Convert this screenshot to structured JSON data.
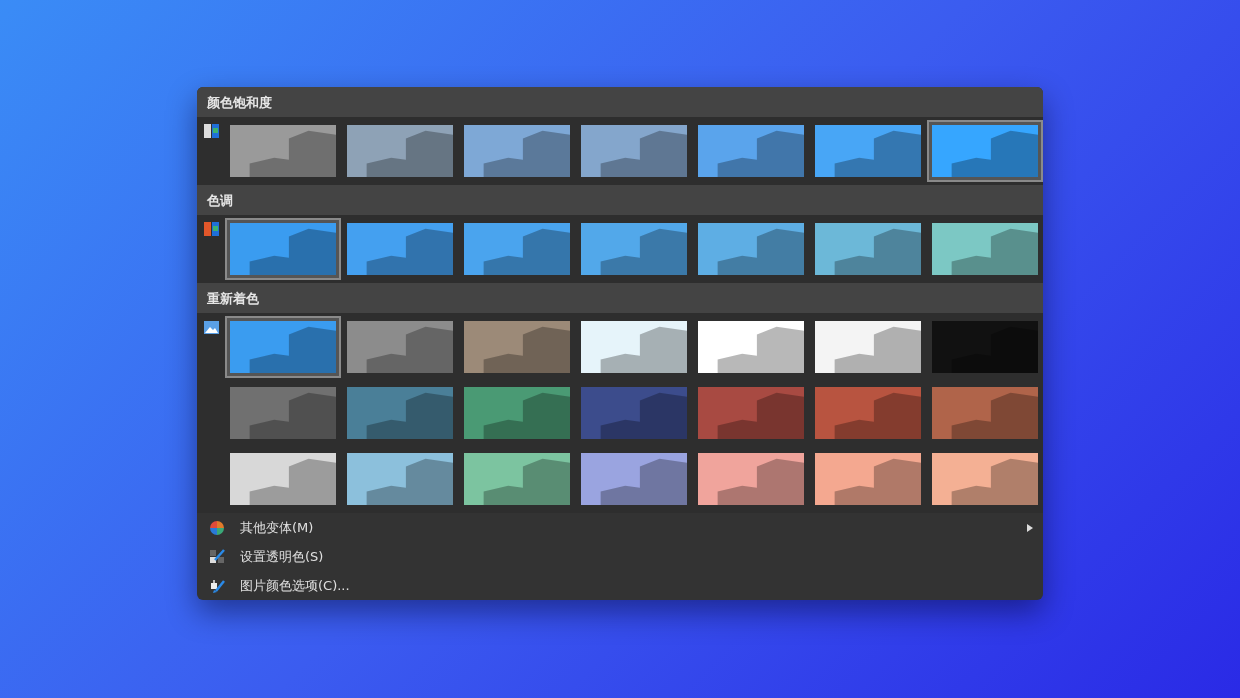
{
  "sections": [
    {
      "title": "颜色饱和度",
      "rows": [
        [
          {
            "color": "#9a9a9a",
            "selected": false
          },
          {
            "color": "#8ea2b6",
            "selected": false
          },
          {
            "color": "#7ea8d6",
            "selected": false
          },
          {
            "color": "#84a6cc",
            "selected": false
          },
          {
            "color": "#5aa4ec",
            "selected": false
          },
          {
            "color": "#48a6f6",
            "selected": false
          },
          {
            "color": "#36a6ff",
            "selected": true
          }
        ]
      ]
    },
    {
      "title": "色调",
      "rows": [
        [
          {
            "color": "#3a9cf0",
            "selected": true
          },
          {
            "color": "#44a0f0",
            "selected": false
          },
          {
            "color": "#4aa4ee",
            "selected": false
          },
          {
            "color": "#52a8ea",
            "selected": false
          },
          {
            "color": "#5eaee4",
            "selected": false
          },
          {
            "color": "#6cb8d8",
            "selected": false
          },
          {
            "color": "#7cc8c4",
            "selected": false
          }
        ]
      ]
    },
    {
      "title": "重新着色",
      "rows": [
        [
          {
            "color": "#3a9cf0",
            "selected": true
          },
          {
            "color": "#8c8c8c",
            "selected": false
          },
          {
            "color": "#9c8a78",
            "selected": false
          },
          {
            "color": "#e6f4fa",
            "selected": false
          },
          {
            "color": "#ffffff",
            "selected": false
          },
          {
            "color": "#f4f4f4",
            "selected": false
          },
          {
            "color": "#111111",
            "selected": false
          }
        ],
        [
          {
            "color": "#707070",
            "selected": false
          },
          {
            "color": "#4a7f98",
            "selected": false
          },
          {
            "color": "#4a9a74",
            "selected": false
          },
          {
            "color": "#3c4c8c",
            "selected": false
          },
          {
            "color": "#a84a42",
            "selected": false
          },
          {
            "color": "#b85440",
            "selected": false
          },
          {
            "color": "#b0644a",
            "selected": false
          }
        ],
        [
          {
            "color": "#d8d8d8",
            "selected": false
          },
          {
            "color": "#8cc0dc",
            "selected": false
          },
          {
            "color": "#7cc4a0",
            "selected": false
          },
          {
            "color": "#9aa4e0",
            "selected": false
          },
          {
            "color": "#f0a49c",
            "selected": false
          },
          {
            "color": "#f4a890",
            "selected": false
          },
          {
            "color": "#f4b094",
            "selected": false
          }
        ]
      ]
    }
  ],
  "commands": [
    {
      "kind": "submenu",
      "label": "其他变体(M)"
    },
    {
      "kind": "plain",
      "label": "设置透明色(S)"
    },
    {
      "kind": "plain",
      "label": "图片颜色选项(C)..."
    }
  ]
}
